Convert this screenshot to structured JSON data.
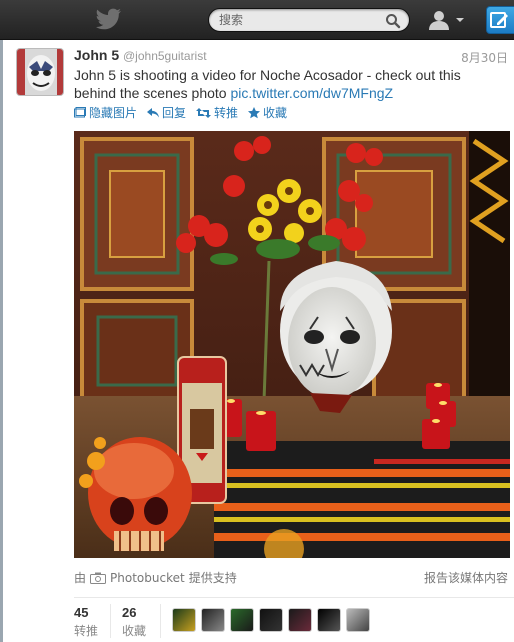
{
  "search": {
    "placeholder": "搜索"
  },
  "tweet": {
    "name": "John 5",
    "handle": "@john5guitarist",
    "date": "8月30日",
    "text": "John 5 is shooting a video for Noche Acosador - check out this behind the scenes photo ",
    "link": "pic.twitter.com/dw7MFngZ",
    "actions": {
      "hide_media": "隐藏图片",
      "reply": "回复",
      "retweet": "转推",
      "favorite": "收藏"
    },
    "media_credit_prefix": "由",
    "media_credit_source": "Photobucket",
    "media_credit_suffix": "提供支持",
    "report_media": "报告该媒体内容"
  },
  "stats": {
    "retweets": {
      "count": "45",
      "label": "转推"
    },
    "favorites": {
      "count": "26",
      "label": "收藏"
    }
  },
  "colors": {
    "link": "#2a7ab5",
    "topbar": "#2b2b2b",
    "compose": "#2a8fd6"
  }
}
